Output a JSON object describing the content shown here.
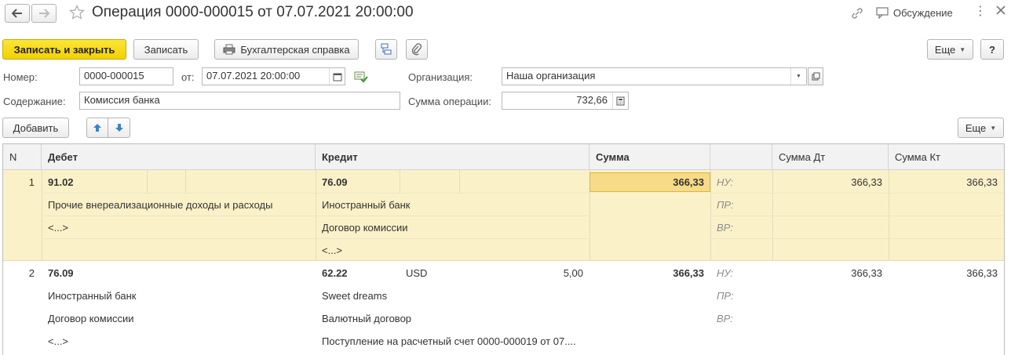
{
  "window": {
    "title": "Операция 0000-000015 от 07.07.2021 20:00:00",
    "discussion_label": "Обсуждение"
  },
  "toolbar": {
    "save_close_label": "Записать и закрыть",
    "save_label": "Записать",
    "report_label": "Бухгалтерская справка",
    "more_label": "Еще",
    "help_label": "?"
  },
  "form": {
    "number_label": "Номер:",
    "number_value": "0000-000015",
    "date_label": "от:",
    "date_value": "07.07.2021 20:00:00",
    "org_label": "Организация:",
    "org_value": "Наша организация",
    "content_label": "Содержание:",
    "content_value": "Комиссия банка",
    "sum_label": "Сумма операции:",
    "sum_value": "732,66"
  },
  "table_toolbar": {
    "add_label": "Добавить",
    "more_label": "Еще"
  },
  "table": {
    "headers": {
      "n": "N",
      "debit": "Дебет",
      "credit": "Кредит",
      "sum": "Сумма",
      "sum_dt": "Сумма Дт",
      "sum_kt": "Сумма Кт"
    },
    "rows": [
      {
        "n": "1",
        "debit_account": "91.02",
        "debit_sub1": "Прочие внереализационные доходы и расходы",
        "debit_sub2": "<...>",
        "debit_sub3": "",
        "credit_account": "76.09",
        "credit_currency": "",
        "credit_amount": "",
        "credit_sub1": "Иностранный банк",
        "credit_sub2": "Договор комиссии",
        "credit_sub3": "<...>",
        "sum": "366,33",
        "tag1": "НУ:",
        "tag2": "ПР:",
        "tag3": "ВР:",
        "sum_dt": "366,33",
        "sum_kt": "366,33"
      },
      {
        "n": "2",
        "debit_account": "76.09",
        "debit_sub1": "Иностранный банк",
        "debit_sub2": "Договор комиссии",
        "debit_sub3": "<...>",
        "credit_account": "62.22",
        "credit_currency": "USD",
        "credit_amount": "5,00",
        "credit_sub1": "Sweet dreams",
        "credit_sub2": "Валютный договор",
        "credit_sub3": "Поступление на расчетный счет 0000-000019 от 07....",
        "sum": "366,33",
        "tag1": "НУ:",
        "tag2": "ПР:",
        "tag3": "ВР:",
        "sum_dt": "366,33",
        "sum_kt": "366,33"
      }
    ]
  },
  "colors": {
    "selected_row": "#fbf1c8",
    "selected_cell": "#f8db87",
    "primary_button": "#f2d100"
  }
}
